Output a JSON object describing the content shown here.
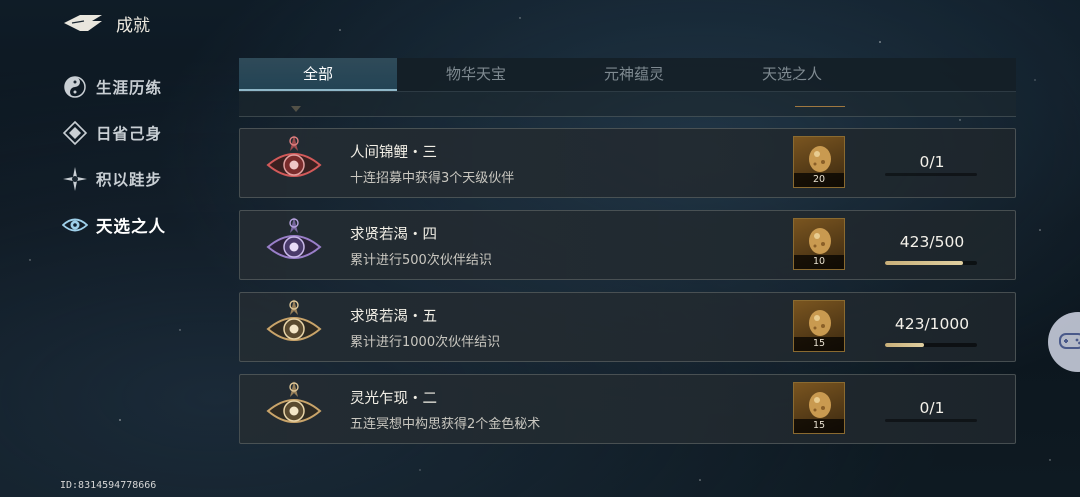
{
  "header": {
    "title": "成就",
    "back_icon": "back-arrow-icon"
  },
  "sidenav": {
    "items": [
      {
        "label": "生涯历练",
        "icon": "yin-yang-icon",
        "active": false
      },
      {
        "label": "日省己身",
        "icon": "diamond-icon",
        "active": false
      },
      {
        "label": "积以跬步",
        "icon": "compass-star-icon",
        "active": false
      },
      {
        "label": "天选之人",
        "icon": "eye-icon",
        "active": true
      }
    ]
  },
  "tabs": [
    {
      "label": "全部",
      "active": true
    },
    {
      "label": "物华天宝",
      "active": false
    },
    {
      "label": "元神蕴灵",
      "active": false
    },
    {
      "label": "天选之人",
      "active": false
    }
  ],
  "achievements": [
    {
      "name": "人间锦鲤・三",
      "desc": "十连招募中获得3个天级伙伴",
      "reward_qty": "20",
      "progress": "0/1",
      "progress_fraction": 0,
      "badge_color": "#d35a5a"
    },
    {
      "name": "求贤若渴・四",
      "desc": "累计进行500次伙伴结识",
      "reward_qty": "10",
      "progress": "423/500",
      "progress_fraction": 0.846,
      "badge_color": "#9a7fc9"
    },
    {
      "name": "求贤若渴・五",
      "desc": "累计进行1000次伙伴结识",
      "reward_qty": "15",
      "progress": "423/1000",
      "progress_fraction": 0.423,
      "badge_color": "#c9a46a"
    },
    {
      "name": "灵光乍现・二",
      "desc": "五连冥想中构思获得2个金色秘术",
      "reward_qty": "15",
      "progress": "0/1",
      "progress_fraction": 0,
      "badge_color": "#c9a46a"
    }
  ],
  "user_id": "ID:8314594778666",
  "colors": {
    "accent": "#8fb7c8",
    "progress_fill": "#d6c08c",
    "reward_border": "#8a6a30"
  },
  "floating_button_icon": "gamepad-icon"
}
